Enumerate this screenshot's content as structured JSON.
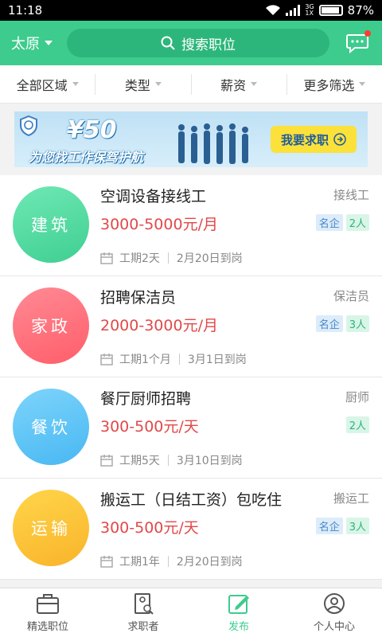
{
  "status_bar": {
    "time": "11:18",
    "battery_pct": "87%",
    "net_3g": "3G",
    "net_1x": "1X"
  },
  "header": {
    "city": "太原",
    "search_placeholder": "搜索职位"
  },
  "filters": [
    {
      "label": "全部区域"
    },
    {
      "label": "类型"
    },
    {
      "label": "薪资"
    },
    {
      "label": "更多筛选"
    }
  ],
  "banner": {
    "amount": "¥50",
    "slogan": "为您找工作保驾护航",
    "cta": "我要求职"
  },
  "jobs": [
    {
      "avatar_text": "建筑",
      "avatar_color": "#4fdca0",
      "title": "空调设备接线工",
      "type": "接线工",
      "salary": "3000-5000元/月",
      "tags": [
        "名企",
        "2人"
      ],
      "duration": "工期2天",
      "start": "2月20日到岗"
    },
    {
      "avatar_text": "家政",
      "avatar_color": "#ff6f7a",
      "title": "招聘保洁员",
      "type": "保洁员",
      "salary": "2000-3000元/月",
      "tags": [
        "名企",
        "3人"
      ],
      "duration": "工期1个月",
      "start": "3月1日到岗"
    },
    {
      "avatar_text": "餐饮",
      "avatar_color": "#5cc4f7",
      "title": "餐厅厨师招聘",
      "type": "厨师",
      "salary": "300-500元/天",
      "tags": [
        "2人"
      ],
      "duration": "工期5天",
      "start": "3月10日到岗"
    },
    {
      "avatar_text": "运输",
      "avatar_color": "#fbc430",
      "title": "搬运工（日结工资）包吃住",
      "type": "搬运工",
      "salary": "300-500元/天",
      "tags": [
        "名企",
        "3人"
      ],
      "duration": "工期1年",
      "start": "2月20日到岗"
    }
  ],
  "tabs": [
    {
      "label": "精选职位",
      "icon": "briefcase-icon"
    },
    {
      "label": "求职者",
      "icon": "resume-icon"
    },
    {
      "label": "发布",
      "icon": "edit-icon"
    },
    {
      "label": "个人中心",
      "icon": "user-icon"
    }
  ],
  "colors": {
    "brand": "#3dcc8e",
    "salary": "#e24848"
  }
}
